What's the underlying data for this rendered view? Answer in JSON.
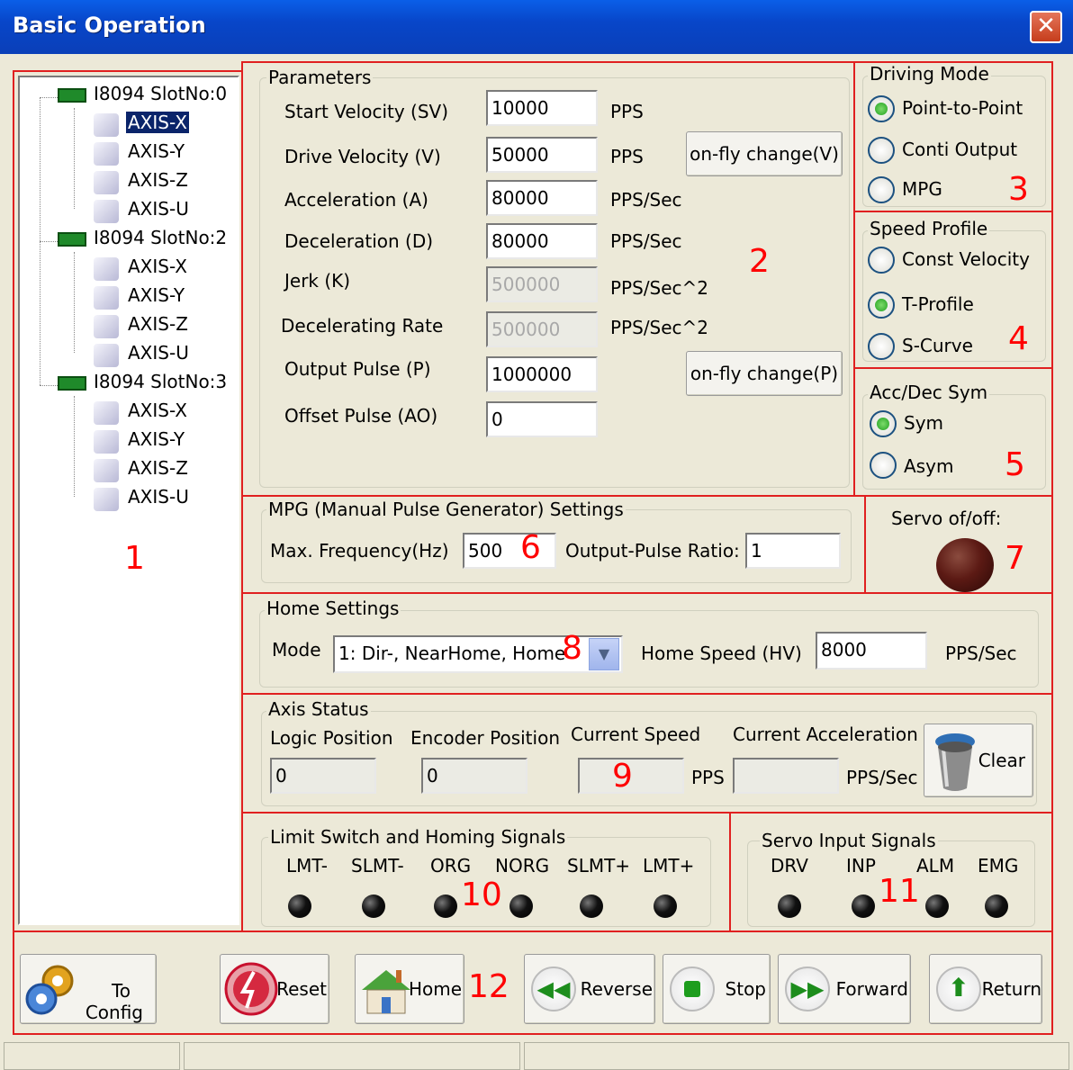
{
  "window": {
    "title": "Basic Operation",
    "close_icon": "close-icon"
  },
  "tree": {
    "slots": [
      {
        "label": "I8094 SlotNo:0",
        "axes": [
          "AXIS-X",
          "AXIS-Y",
          "AXIS-Z",
          "AXIS-U"
        ]
      },
      {
        "label": "I8094 SlotNo:2",
        "axes": [
          "AXIS-X",
          "AXIS-Y",
          "AXIS-Z",
          "AXIS-U"
        ]
      },
      {
        "label": "I8094 SlotNo:3",
        "axes": [
          "AXIS-X",
          "AXIS-Y",
          "AXIS-Z",
          "AXIS-U"
        ]
      }
    ],
    "selected": "AXIS-X"
  },
  "parameters": {
    "title": "Parameters",
    "start_velocity": {
      "label": "Start Velocity (SV)",
      "value": "10000",
      "unit": "PPS"
    },
    "drive_velocity": {
      "label": "Drive Velocity (V)",
      "value": "50000",
      "unit": "PPS"
    },
    "acceleration": {
      "label": "Acceleration (A)",
      "value": "80000",
      "unit": "PPS/Sec"
    },
    "deceleration": {
      "label": "Deceleration (D)",
      "value": "80000",
      "unit": "PPS/Sec"
    },
    "jerk": {
      "label": "Jerk (K)",
      "value": "500000",
      "unit": "PPS/Sec^2"
    },
    "decel_rate": {
      "label": "Decelerating Rate",
      "value": "500000",
      "unit": "PPS/Sec^2"
    },
    "output_pulse": {
      "label": "Output Pulse (P)",
      "value": "1000000"
    },
    "offset_pulse": {
      "label": "Offset Pulse (AO)",
      "value": "0"
    },
    "onfly_v": "on-fly change(V)",
    "onfly_p": "on-fly change(P)"
  },
  "driving_mode": {
    "title": "Driving Mode",
    "options": [
      "Point-to-Point",
      "Conti Output",
      "MPG"
    ],
    "selected": "Point-to-Point"
  },
  "speed_profile": {
    "title": "Speed Profile",
    "options": [
      "Const Velocity",
      "T-Profile",
      "S-Curve"
    ],
    "selected": "T-Profile"
  },
  "acc_dec_sym": {
    "title": "Acc/Dec Sym",
    "options": [
      "Sym",
      "Asym"
    ],
    "selected": "Sym"
  },
  "mpg": {
    "title": "MPG (Manual Pulse Generator) Settings",
    "max_freq_label": "Max. Frequency(Hz)",
    "max_freq": "500",
    "ratio_label": "Output-Pulse Ratio:",
    "ratio": "1"
  },
  "servo": {
    "label": "Servo of/off:"
  },
  "home": {
    "title": "Home Settings",
    "mode_label": "Mode",
    "mode_value": "1: Dir-, NearHome, Home",
    "speed_label": "Home Speed (HV)",
    "speed_value": "8000",
    "speed_unit": "PPS/Sec"
  },
  "axis_status": {
    "title": "Axis Status",
    "logic_label": "Logic Position",
    "logic_value": "0",
    "encoder_label": "Encoder Position",
    "encoder_value": "0",
    "speed_label": "Current Speed",
    "speed_unit": "PPS",
    "accel_label": "Current Acceleration",
    "accel_unit": "PPS/Sec",
    "clear_label": "Clear"
  },
  "limit_signals": {
    "title": "Limit Switch and Homing Signals",
    "labels": [
      "LMT-",
      "SLMT-",
      "ORG",
      "NORG",
      "SLMT+",
      "LMT+"
    ]
  },
  "servo_signals": {
    "title": "Servo Input Signals",
    "labels": [
      "DRV",
      "INP",
      "ALM",
      "EMG"
    ]
  },
  "buttons": {
    "config_1": "To",
    "config_2": "Config",
    "reset": "Reset",
    "home": "Home",
    "reverse": "Reverse",
    "stop": "Stop",
    "forward": "Forward",
    "return": "Return"
  },
  "annotations": [
    "1",
    "2",
    "3",
    "4",
    "5",
    "6",
    "7",
    "8",
    "9",
    "10",
    "11",
    "12"
  ],
  "colors": {
    "annotation_red": "#ff0000",
    "titlebar_blue": "#0a46c9",
    "led_on_green": "#21a121"
  }
}
